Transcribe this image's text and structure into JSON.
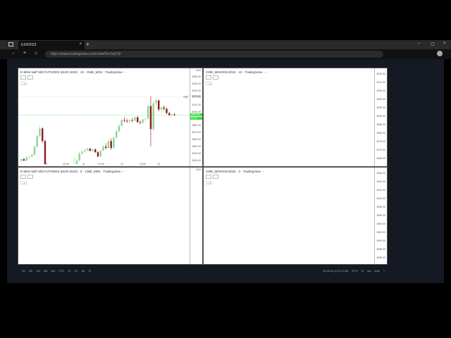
{
  "browser": {
    "tab_title": "ESH2023",
    "url": "https://www.tradingview.com/chart/DxcSqTl3/",
    "new_tab": "+",
    "close_tab": "×",
    "window_controls": [
      "–",
      "▢",
      "×"
    ]
  },
  "charts": [
    {
      "legend": "E-MINI S&P 500 FUTURES (MAR 2023) · 1h · CME_MINI · TradingView",
      "currency": "USD",
      "collapse": "⌄ 4",
      "more": "···",
      "price_labels": [
        "4050.00",
        "4040.00",
        "4030.00",
        "4010.00",
        "4000.00",
        "3980.00",
        "3970.00",
        "3960.00",
        "3950.00",
        "3940.00",
        "3930.00"
      ],
      "high_label": "High",
      "high_value": "4021.50",
      "last_price": "3995.00",
      "countdown": "54:32",
      "time_labels": [
        "10",
        "12:00",
        "11",
        "12:00",
        "12",
        "12:00",
        "13"
      ]
    },
    {
      "legend": "CME_MINI:ESH2023 · 15 · TradingView",
      "more": "···",
      "collapse": "⌄ 4",
      "price_labels": [
        "4015.00",
        "4010.00",
        "4005.00",
        "4000.00",
        "3995.00",
        "3990.00",
        "3985.00",
        "3980.00",
        "3975.00",
        "3970.00",
        "3965.00"
      ]
    },
    {
      "legend": "E-MINI S&P 500 FUTURES (MAR 2023) · 5 · CME_MINI · TradingView",
      "currency": "USD",
      "more": "···",
      "collapse": "⌄ 4"
    },
    {
      "legend": "CME_MINI:ESH2023 · 2 · TradingView",
      "more": "···",
      "collapse": "⌄ 4",
      "price_labels": [
        "4006.00",
        "4004.00",
        "4002.00",
        "4000.00",
        "3998.00",
        "3996.00",
        "3994.00",
        "3992.00",
        "3990.00",
        "3988.00",
        "3986.00"
      ]
    }
  ],
  "bottom": {
    "ranges": [
      "1D",
      "5D",
      "1M",
      "3M",
      "6M",
      "YTD",
      "1Y",
      "5Y",
      "All"
    ],
    "time": "10:35:24 (UTC-5:30)",
    "session": "ETH",
    "percent": "%",
    "log": "log",
    "auto": "auto"
  },
  "colors": {
    "up": "#8fd48f",
    "down": "#8b1c1c",
    "last": "#33dd33"
  },
  "chart_data": {
    "type": "candlestick",
    "title": "E-MINI S&P 500 FUTURES (MAR 2023) 1h",
    "ylim": [
      3925,
      4062
    ],
    "x_ticks": [
      "10",
      "12:00",
      "11",
      "12:00",
      "12",
      "12:00",
      "13"
    ],
    "candles": [
      [
        3930,
        3933,
        3928,
        3932
      ],
      [
        3932,
        3934,
        3929,
        3930
      ],
      [
        3930,
        3936,
        3929,
        3935
      ],
      [
        3935,
        3937,
        3932,
        3936
      ],
      [
        3936,
        3940,
        3933,
        3938
      ],
      [
        3938,
        3952,
        3937,
        3950
      ],
      [
        3950,
        3968,
        3948,
        3965
      ],
      [
        3965,
        3980,
        3962,
        3976
      ],
      [
        3976,
        3978,
        3955,
        3958
      ],
      [
        3958,
        3960,
        3920,
        3922
      ],
      [
        3922,
        3924,
        3905,
        3908
      ],
      [
        3908,
        3912,
        3900,
        3903
      ],
      [
        3903,
        3906,
        3898,
        3900
      ],
      [
        3900,
        3904,
        3896,
        3902
      ],
      [
        3902,
        3905,
        3897,
        3899
      ],
      [
        3899,
        3903,
        3895,
        3901
      ],
      [
        3901,
        3906,
        3899,
        3904
      ],
      [
        3904,
        3910,
        3902,
        3908
      ],
      [
        3908,
        3915,
        3906,
        3912
      ],
      [
        3912,
        3918,
        3910,
        3916
      ],
      [
        3916,
        3935,
        3915,
        3920
      ],
      [
        3920,
        3932,
        3919,
        3930
      ],
      [
        3930,
        3942,
        3929,
        3940
      ],
      [
        3940,
        3945,
        3938,
        3943
      ],
      [
        3943,
        3947,
        3941,
        3945
      ],
      [
        3945,
        3949,
        3943,
        3947
      ],
      [
        3947,
        3948,
        3943,
        3944
      ],
      [
        3944,
        3947,
        3942,
        3946
      ],
      [
        3946,
        3947,
        3941,
        3942
      ],
      [
        3942,
        3944,
        3935,
        3936
      ],
      [
        3936,
        3945,
        3935,
        3944
      ],
      [
        3944,
        3952,
        3943,
        3950
      ],
      [
        3950,
        3955,
        3946,
        3948
      ],
      [
        3948,
        3960,
        3947,
        3958
      ],
      [
        3958,
        3962,
        3945,
        3948
      ],
      [
        3948,
        3965,
        3947,
        3963
      ],
      [
        3963,
        3975,
        3960,
        3972
      ],
      [
        3972,
        3982,
        3970,
        3980
      ],
      [
        3980,
        3990,
        3978,
        3988
      ],
      [
        3988,
        3992,
        3985,
        3987
      ],
      [
        3987,
        3990,
        3984,
        3986
      ],
      [
        3986,
        3989,
        3983,
        3988
      ],
      [
        3988,
        3991,
        3985,
        3987
      ],
      [
        3987,
        3993,
        3986,
        3992
      ],
      [
        3992,
        3994,
        3984,
        3985
      ],
      [
        3985,
        3988,
        3982,
        3984
      ],
      [
        3984,
        3990,
        3983,
        3989
      ],
      [
        3989,
        3991,
        3986,
        3990
      ],
      [
        3990,
        4010,
        3988,
        4008
      ],
      [
        4008,
        4022,
        3950,
        3975
      ],
      [
        3975,
        4015,
        3972,
        4012
      ],
      [
        4012,
        4018,
        4005,
        4016
      ],
      [
        4016,
        4017,
        4000,
        4003
      ],
      [
        4003,
        4008,
        3998,
        4006
      ],
      [
        4006,
        4009,
        4001,
        4004
      ],
      [
        4004,
        4006,
        3996,
        3998
      ],
      [
        3998,
        4000,
        3994,
        3995
      ],
      [
        3995,
        3997,
        3993,
        3996
      ],
      [
        3996,
        3998,
        3994,
        3995
      ]
    ]
  }
}
